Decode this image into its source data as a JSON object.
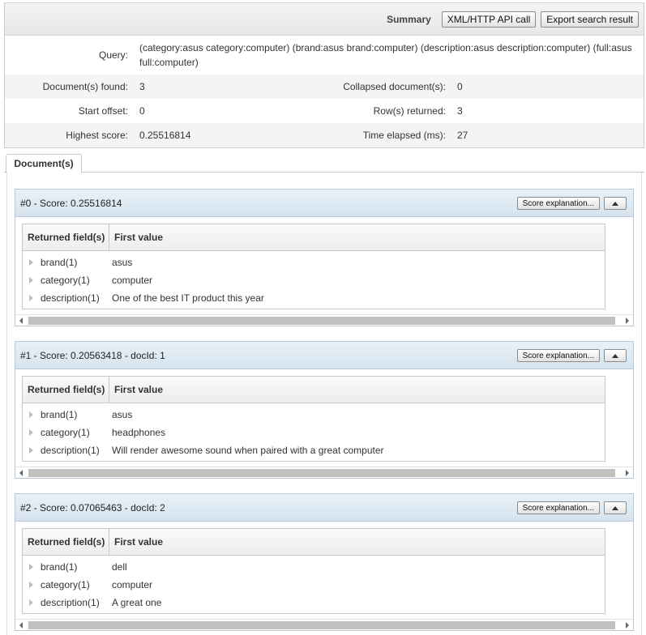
{
  "summary": {
    "title": "Summary",
    "api_button": "XML/HTTP API call",
    "export_button": "Export search result",
    "query_label": "Query:",
    "query_value": "(category:asus category:computer) (brand:asus brand:computer) (description:asus description:computer) (full:asus full:computer)",
    "docs_found_label": "Document(s) found:",
    "docs_found_value": "3",
    "collapsed_label": "Collapsed document(s):",
    "collapsed_value": "0",
    "start_offset_label": "Start offset:",
    "start_offset_value": "0",
    "rows_returned_label": "Row(s) returned:",
    "rows_returned_value": "3",
    "highest_score_label": "Highest score:",
    "highest_score_value": "0.25516814",
    "time_elapsed_label": "Time elapsed (ms):",
    "time_elapsed_value": "27"
  },
  "tabs": [
    {
      "label": "Document(s)"
    }
  ],
  "documents": [
    {
      "title": "#0 - Score: 0.25516814",
      "score_button": "Score explanation...",
      "col_field": "Returned field(s)",
      "col_value": "First value",
      "fields": [
        {
          "name": "brand(1)",
          "value": "asus"
        },
        {
          "name": "category(1)",
          "value": "computer"
        },
        {
          "name": "description(1)",
          "value": "One of the best IT product this year"
        }
      ]
    },
    {
      "title": "#1 - Score: 0.20563418 - docId: 1",
      "score_button": "Score explanation...",
      "col_field": "Returned field(s)",
      "col_value": "First value",
      "fields": [
        {
          "name": "brand(1)",
          "value": "asus"
        },
        {
          "name": "category(1)",
          "value": "headphones"
        },
        {
          "name": "description(1)",
          "value": "Will render awesome sound when paired with a great computer"
        }
      ]
    },
    {
      "title": "#2 - Score: 0.07065463 - docId: 2",
      "score_button": "Score explanation...",
      "col_field": "Returned field(s)",
      "col_value": "First value",
      "fields": [
        {
          "name": "brand(1)",
          "value": "dell"
        },
        {
          "name": "category(1)",
          "value": "computer"
        },
        {
          "name": "description(1)",
          "value": "A great one"
        }
      ]
    }
  ]
}
